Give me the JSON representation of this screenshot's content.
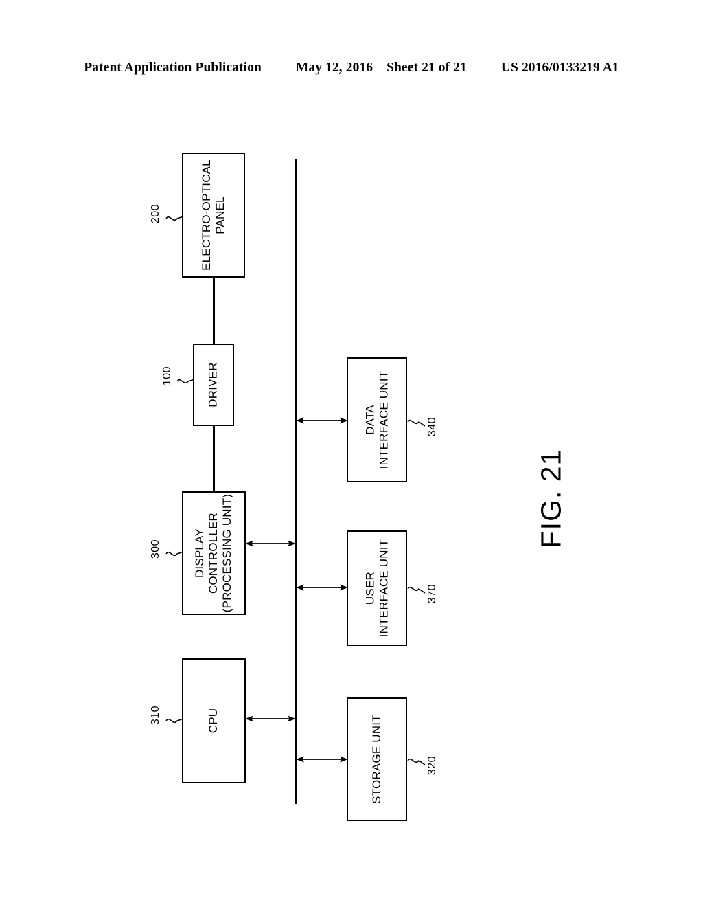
{
  "header": {
    "publication": "Patent Application Publication",
    "date": "May 12, 2016",
    "sheet": "Sheet 21 of 21",
    "patent_number": "US 2016/0133219 A1"
  },
  "figure": {
    "caption": "FIG. 21"
  },
  "blocks": {
    "electro_optical_panel": {
      "line1": "ELECTRO-OPTICAL",
      "line2": "PANEL",
      "ref": "200"
    },
    "driver": {
      "line1": "DRIVER",
      "ref": "100"
    },
    "display_controller": {
      "line1": "DISPLAY",
      "line2": "CONTROLLER",
      "line3": "(PROCESSING UNIT)",
      "ref": "300"
    },
    "cpu": {
      "line1": "CPU",
      "ref": "310"
    },
    "data_interface_unit": {
      "line1": "DATA",
      "line2": "INTERFACE UNIT",
      "ref": "340"
    },
    "user_interface_unit": {
      "line1": "USER",
      "line2": "INTERFACE UNIT",
      "ref": "370"
    },
    "storage_unit": {
      "line1": "STORAGE UNIT",
      "ref": "320"
    }
  },
  "colors": {
    "ink": "#000000",
    "paper": "#ffffff"
  }
}
